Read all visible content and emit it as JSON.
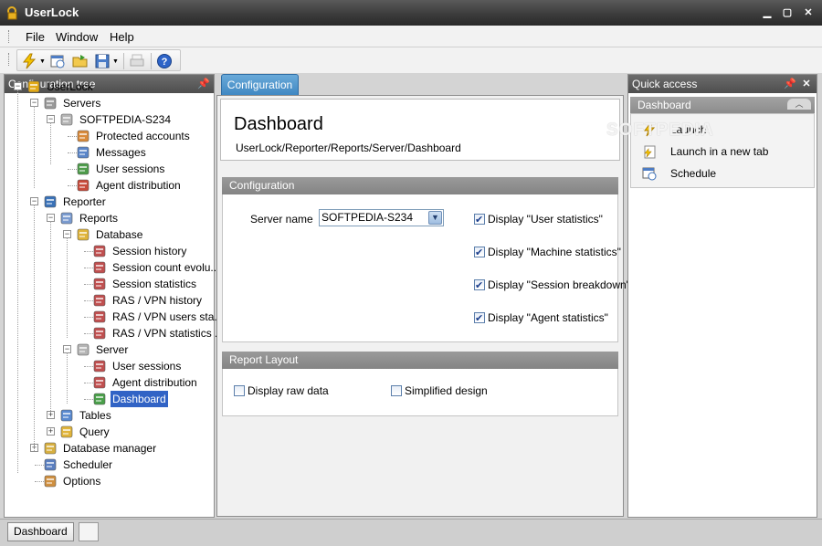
{
  "window": {
    "title": "UserLock",
    "minimize_icon": "minimize-icon",
    "maximize_icon": "maximize-icon",
    "close_icon": "close-icon"
  },
  "menu": {
    "file": "File",
    "window": "Window",
    "help": "Help"
  },
  "toolbar": {
    "icons": [
      "lightning-icon",
      "schedule-icon",
      "open-folder-icon",
      "save-icon",
      "print-icon",
      "help-icon"
    ]
  },
  "config_tree": {
    "title": "Configuration tree",
    "items": [
      {
        "label": "UserLock",
        "icon": "userlock-icon"
      },
      {
        "label": "Servers",
        "icon": "servers-icon"
      },
      {
        "label": "SOFTPEDIA-S234",
        "icon": "server-icon"
      },
      {
        "label": "Protected accounts",
        "icon": "accounts-icon"
      },
      {
        "label": "Messages",
        "icon": "messages-icon"
      },
      {
        "label": "User sessions",
        "icon": "sessions-icon"
      },
      {
        "label": "Agent distribution",
        "icon": "agent-icon"
      },
      {
        "label": "Reporter",
        "icon": "reporter-icon"
      },
      {
        "label": "Reports",
        "icon": "reports-icon"
      },
      {
        "label": "Database",
        "icon": "database-icon"
      },
      {
        "label": "Session history",
        "icon": "report-icon"
      },
      {
        "label": "Session count evolu...",
        "icon": "report-icon"
      },
      {
        "label": "Session statistics",
        "icon": "report-icon"
      },
      {
        "label": "RAS / VPN history",
        "icon": "report-icon"
      },
      {
        "label": "RAS / VPN users sta...",
        "icon": "report-icon"
      },
      {
        "label": "RAS / VPN statistics ...",
        "icon": "report-icon"
      },
      {
        "label": "Server",
        "icon": "server-icon"
      },
      {
        "label": "User sessions",
        "icon": "report-icon"
      },
      {
        "label": "Agent distribution",
        "icon": "report-icon"
      },
      {
        "label": "Dashboard",
        "icon": "dashboard-icon"
      },
      {
        "label": "Tables",
        "icon": "tables-icon"
      },
      {
        "label": "Query",
        "icon": "query-icon"
      },
      {
        "label": "Database manager",
        "icon": "database-manager-icon"
      },
      {
        "label": "Scheduler",
        "icon": "scheduler-icon"
      },
      {
        "label": "Options",
        "icon": "options-icon"
      }
    ]
  },
  "center": {
    "tab": "Configuration",
    "title": "Dashboard",
    "path": "UserLock/Reporter/Reports/Server/Dashboard",
    "configuration_section": "Configuration",
    "server_name_label": "Server name",
    "server_name_value": "SOFTPEDIA-S234",
    "checkboxes": [
      {
        "label": "Display \"User statistics\"",
        "checked": true
      },
      {
        "label": "Display \"Machine statistics\"",
        "checked": true
      },
      {
        "label": "Display \"Session breakdown\"",
        "checked": true
      },
      {
        "label": "Display \"Agent statistics\"",
        "checked": true
      }
    ],
    "layout_section": "Report Layout",
    "raw_data_label": "Display raw data",
    "raw_data_checked": false,
    "simplified_label": "Simplified design",
    "simplified_checked": false
  },
  "quick_access": {
    "title": "Quick access",
    "group": "Dashboard",
    "items": [
      {
        "label": "Launch",
        "icon": "lightning-icon"
      },
      {
        "label": "Launch in a new tab",
        "icon": "new-tab-icon"
      },
      {
        "label": "Schedule",
        "icon": "schedule-icon"
      }
    ]
  },
  "watermark": "SOFTPEDIA",
  "statusbar": {
    "tab": "Dashboard"
  },
  "colors": {
    "selection": "#3163c5",
    "tab_accent": "#3d86c2",
    "header_dark": "#4e4e4e"
  }
}
